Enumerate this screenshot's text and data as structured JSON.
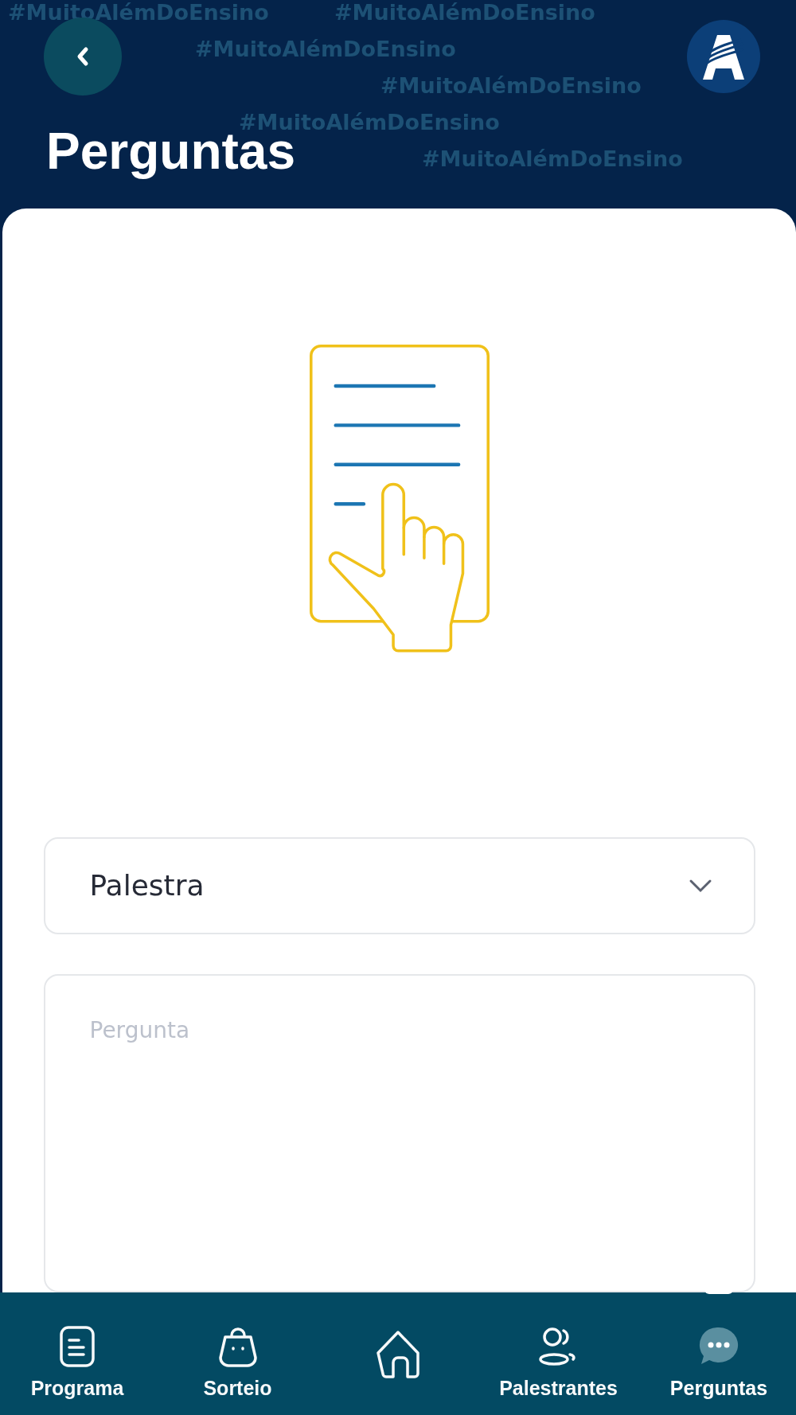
{
  "header": {
    "pattern_rows": [
      [
        "#MuitoAlémDoEnsino",
        "#MuitoAlémDoEnsino"
      ],
      [
        "#MuitoAlémDoEnsino"
      ],
      [
        "#MuitoAlémDoEnsino"
      ],
      [
        "#MuitoAlémDoEnsino"
      ],
      [
        "#MuitoAlémDoEnsino"
      ]
    ],
    "title": "Perguntas"
  },
  "form": {
    "select": {
      "value": "Palestra"
    },
    "question": {
      "placeholder": "Pergunta"
    }
  },
  "nav": [
    {
      "kind": "document",
      "label": "Programa",
      "selected": false
    },
    {
      "kind": "bag",
      "label": "Sorteio",
      "selected": false
    },
    {
      "kind": "home",
      "selected": false
    },
    {
      "kind": "people",
      "label": "Palestrantes",
      "selected": false
    },
    {
      "kind": "chat",
      "label": "Perguntas",
      "selected": true
    }
  ]
}
